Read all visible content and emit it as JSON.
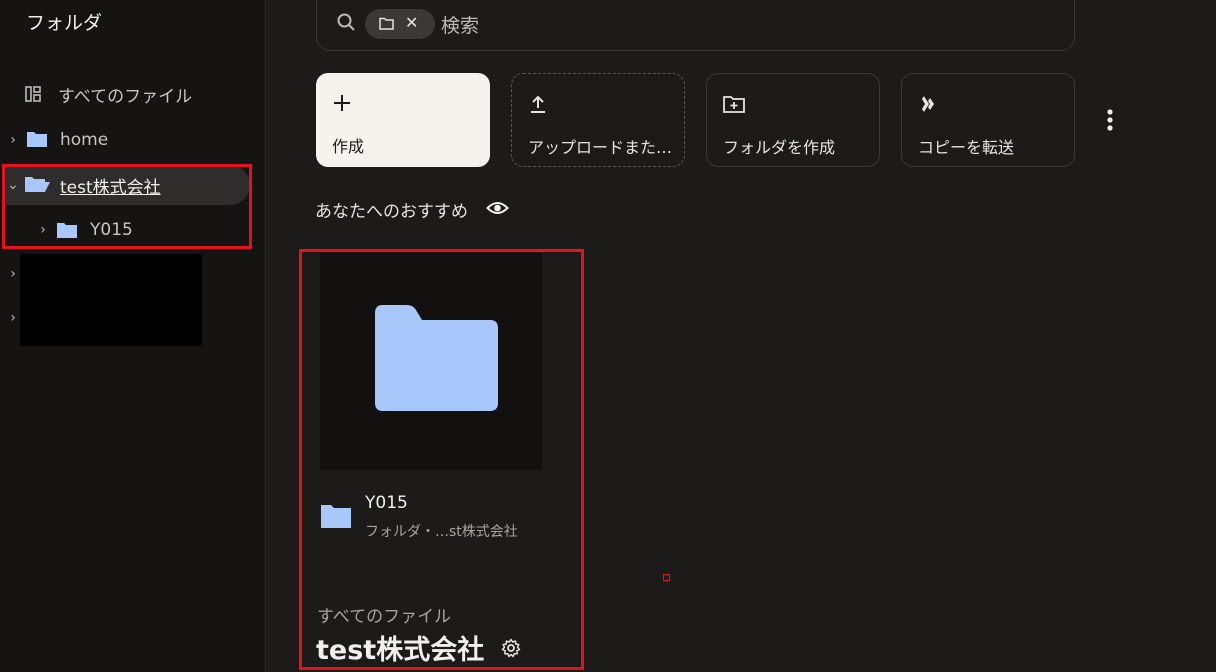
{
  "sidebar": {
    "title": "フォルダ",
    "all_files": "すべてのファイル",
    "items": [
      {
        "label": "home"
      },
      {
        "label": "test株式会社"
      },
      {
        "label": "Y015"
      }
    ]
  },
  "search": {
    "placeholder": "検索"
  },
  "actions": [
    {
      "label": "作成",
      "icon": "plus-icon"
    },
    {
      "label": "アップロードまた…",
      "icon": "upload-icon"
    },
    {
      "label": "フォルダを作成",
      "icon": "new-folder-icon"
    },
    {
      "label": "コピーを転送",
      "icon": "transfer-icon"
    }
  ],
  "recommendations": {
    "title": "あなたへのおすすめ",
    "card": {
      "name": "Y015",
      "subtitle": "フォルダ・…st株式会社"
    }
  },
  "breadcrumb": "すべてのファイル",
  "page_title": "test株式会社",
  "colors": {
    "accent_folder": "#a8c7fa",
    "highlight": "#e5121c"
  }
}
